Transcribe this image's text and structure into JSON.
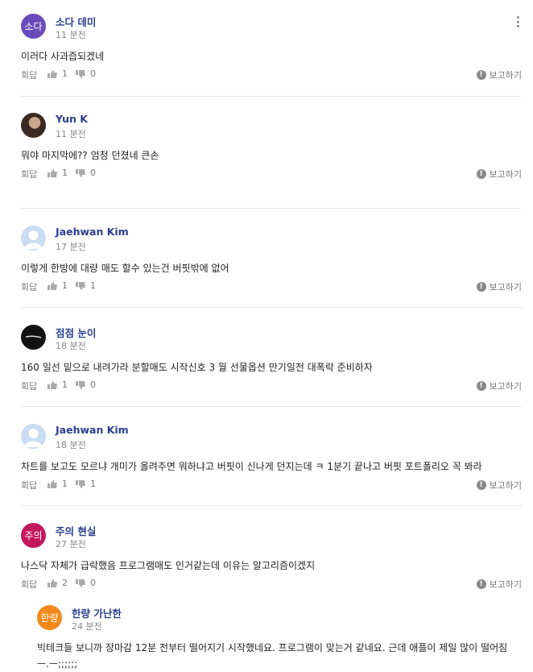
{
  "labels": {
    "reply": "회답",
    "report": "보고하기",
    "alert": "!"
  },
  "comments": [
    {
      "avatar_text": "소다",
      "avatar_color": "#6a4bb8",
      "author": "소다 데미",
      "time": "11 분전",
      "text": "이러다 사과즙되겠네",
      "likes": "1",
      "dislikes": "0"
    },
    {
      "avatar_text": "",
      "avatar_color": "#3b2a22",
      "author": "Yun K",
      "time": "11 분전",
      "text": "뭐야 마지막에?? 엄청 던졌네 큰손",
      "likes": "1",
      "dislikes": "0"
    },
    {
      "avatar_text": "",
      "avatar_color": "#c9dcf2",
      "author": "Jaehwan Kim",
      "time": "17 분전",
      "text": "이렇게 한방에 대량 매도 할수 있는건 버핏밖에 없어",
      "likes": "1",
      "dislikes": "1"
    },
    {
      "avatar_text": "",
      "avatar_color": "#111111",
      "author": "점점 눈이",
      "time": "18 분전",
      "text": "160 일선 밑으로 내려가라 분할매도 시작신호   3 월 선물옵션 만기일전 대폭락 준비하자",
      "likes": "1",
      "dislikes": "0"
    },
    {
      "avatar_text": "",
      "avatar_color": "#c9dcf2",
      "author": "Jaehwan Kim",
      "time": "18 분전",
      "text": "차트를 보고도 모르냐 개미가 올려주면 뭐하냐고 버핏이 신나게 던지는데 ㅋ 1분기 끝나고 버핏 포트폴리오 꼭 봐라",
      "likes": "1",
      "dislikes": "1"
    },
    {
      "avatar_text": "주의",
      "avatar_color": "#c2185b",
      "author": "주의 현실",
      "time": "27 분전",
      "text": "나스닥 자체가 급락했음 프로그램매도 인거같는데 이유는 알고리즘이겠지",
      "likes": "2",
      "dislikes": "0"
    }
  ],
  "reply": {
    "avatar_text": "한량",
    "avatar_color": "#f08a1c",
    "author": "한량 가난한",
    "time": "24 분전",
    "text": "빅테크들 보니까 장마감 12분 전부터 떨어지기 시작했네요. 프로그램이 맞는거 같네요. 근데 애플이 제일 많이 떨어짐 ㅡ.ㅡ;;;;;;"
  }
}
